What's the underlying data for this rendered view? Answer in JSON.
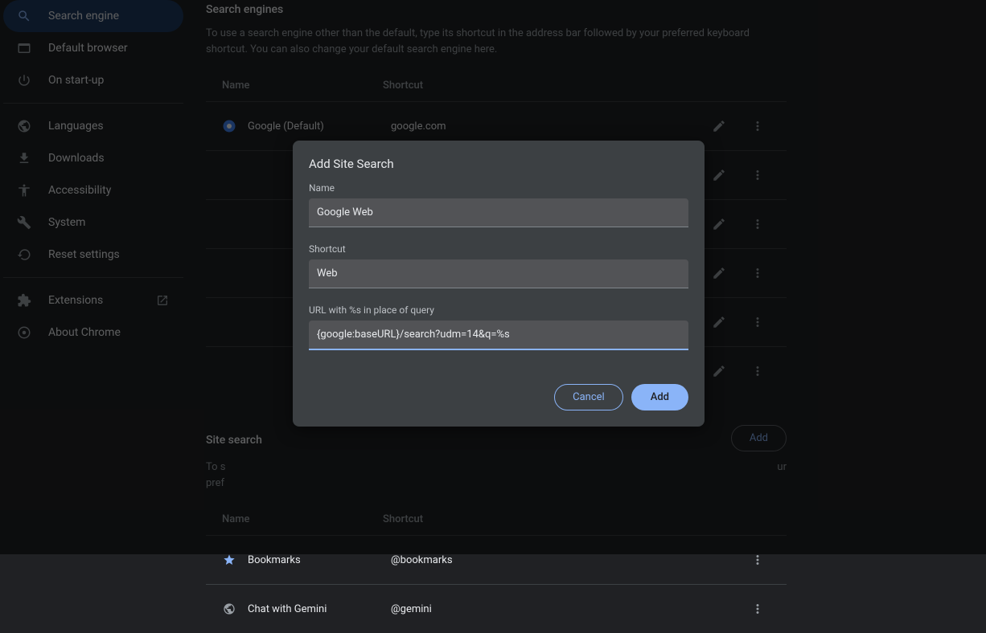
{
  "sidebar": {
    "items": [
      {
        "label": "Search engine",
        "icon": "search"
      },
      {
        "label": "Default browser",
        "icon": "browser"
      },
      {
        "label": "On start-up",
        "icon": "power"
      }
    ],
    "group2": [
      {
        "label": "Languages",
        "icon": "globe"
      },
      {
        "label": "Downloads",
        "icon": "download"
      },
      {
        "label": "Accessibility",
        "icon": "accessibility"
      },
      {
        "label": "System",
        "icon": "wrench"
      },
      {
        "label": "Reset settings",
        "icon": "history"
      }
    ],
    "group3": [
      {
        "label": "Extensions",
        "icon": "puzzle",
        "external": true
      },
      {
        "label": "About Chrome",
        "icon": "chrome"
      }
    ]
  },
  "main": {
    "searchEngines": {
      "title": "Search engines",
      "desc": "To use a search engine other than the default, type its shortcut in the address bar followed by your preferred keyboard shortcut. You can also change your default search engine here.",
      "headers": {
        "name": "Name",
        "shortcut": "Shortcut"
      },
      "rows": [
        {
          "name": "Google (Default)",
          "shortcut": "google.com",
          "favicon": "google"
        },
        {
          "name": "",
          "shortcut": ""
        },
        {
          "name": "",
          "shortcut": ""
        },
        {
          "name": "",
          "shortcut": ""
        },
        {
          "name": "",
          "shortcut": ""
        },
        {
          "name": "",
          "shortcut": ""
        }
      ]
    },
    "siteSearch": {
      "title": "Site search",
      "desc_partial_left": "To s",
      "desc_partial_right": "ur",
      "desc_bottom": "pref",
      "addLabel": "Add",
      "headers": {
        "name": "Name",
        "shortcut": "Shortcut"
      },
      "rows": [
        {
          "name": "Bookmarks",
          "shortcut": "@bookmarks",
          "favicon": "star"
        },
        {
          "name": "Chat with Gemini",
          "shortcut": "@gemini",
          "favicon": "globe"
        }
      ]
    }
  },
  "modal": {
    "title": "Add Site Search",
    "nameLabel": "Name",
    "nameValue": "Google Web",
    "shortcutLabel": "Shortcut",
    "shortcutValue": "Web",
    "urlLabel": "URL with %s in place of query",
    "urlValue": "{google:baseURL}/search?udm=14&q=%s",
    "cancelLabel": "Cancel",
    "addLabel": "Add"
  }
}
